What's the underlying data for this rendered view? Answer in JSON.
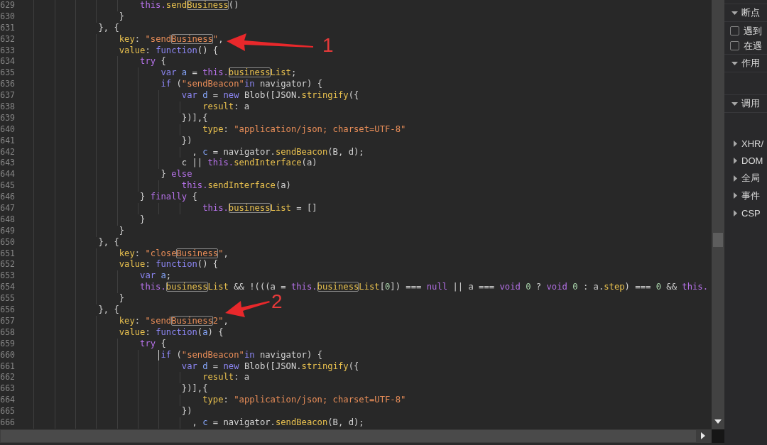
{
  "editor": {
    "lines": [
      {
        "number": "629",
        "caret": false,
        "tokens": [
          {
            "text": "                        this.",
            "kind": "special",
            "match": false
          },
          {
            "text": "send",
            "kind": "property",
            "match": false
          },
          {
            "text": "Business",
            "kind": "property",
            "match": true
          },
          {
            "text": "()",
            "kind": "plain",
            "match": false
          }
        ]
      },
      {
        "number": "630",
        "caret": false,
        "tokens": [
          {
            "text": "                    }",
            "kind": "plain",
            "match": false
          }
        ]
      },
      {
        "number": "631",
        "caret": false,
        "tokens": [
          {
            "text": "                }, {",
            "kind": "plain",
            "match": false
          }
        ]
      },
      {
        "number": "632",
        "caret": false,
        "callout": "1",
        "tokens": [
          {
            "text": "                    key",
            "kind": "property",
            "match": false
          },
          {
            "text": ": ",
            "kind": "plain",
            "match": false
          },
          {
            "text": "\"send",
            "kind": "string",
            "match": false
          },
          {
            "text": "Business",
            "kind": "string",
            "match": true
          },
          {
            "text": "\"",
            "kind": "string",
            "match": false
          },
          {
            "text": ",",
            "kind": "plain",
            "match": false
          }
        ]
      },
      {
        "number": "633",
        "caret": false,
        "tokens": [
          {
            "text": "                    value",
            "kind": "property",
            "match": false
          },
          {
            "text": ": ",
            "kind": "plain",
            "match": false
          },
          {
            "text": "function",
            "kind": "keyword",
            "match": false
          },
          {
            "text": "() {",
            "kind": "plain",
            "match": false
          }
        ]
      },
      {
        "number": "634",
        "caret": false,
        "tokens": [
          {
            "text": "                        try",
            "kind": "special",
            "match": false
          },
          {
            "text": " {",
            "kind": "plain",
            "match": false
          }
        ]
      },
      {
        "number": "635",
        "caret": false,
        "tokens": [
          {
            "text": "                            var ",
            "kind": "keyword",
            "match": false
          },
          {
            "text": "a",
            "kind": "variable",
            "match": false
          },
          {
            "text": " = ",
            "kind": "plain",
            "match": false
          },
          {
            "text": "this.",
            "kind": "special",
            "match": false
          },
          {
            "text": "business",
            "kind": "property",
            "match": true
          },
          {
            "text": "List",
            "kind": "property",
            "match": false
          },
          {
            "text": ";",
            "kind": "plain",
            "match": false
          }
        ]
      },
      {
        "number": "636",
        "caret": false,
        "tokens": [
          {
            "text": "                            if",
            "kind": "keyword",
            "match": false
          },
          {
            "text": " (",
            "kind": "plain",
            "match": false
          },
          {
            "text": "\"sendBeacon\"",
            "kind": "string",
            "match": false
          },
          {
            "text": "in",
            "kind": "keyword",
            "match": false
          },
          {
            "text": " navigator) {",
            "kind": "plain",
            "match": false
          }
        ]
      },
      {
        "number": "637",
        "caret": false,
        "tokens": [
          {
            "text": "                                var ",
            "kind": "keyword",
            "match": false
          },
          {
            "text": "d",
            "kind": "variable",
            "match": false
          },
          {
            "text": " = ",
            "kind": "plain",
            "match": false
          },
          {
            "text": "new",
            "kind": "keyword",
            "match": false
          },
          {
            "text": " Blob([JSON.",
            "kind": "plain",
            "match": false
          },
          {
            "text": "stringify",
            "kind": "property",
            "match": false
          },
          {
            "text": "({",
            "kind": "plain",
            "match": false
          }
        ]
      },
      {
        "number": "638",
        "caret": false,
        "tokens": [
          {
            "text": "                                    result",
            "kind": "property",
            "match": false
          },
          {
            "text": ": a",
            "kind": "plain",
            "match": false
          }
        ]
      },
      {
        "number": "639",
        "caret": false,
        "tokens": [
          {
            "text": "                                })],{",
            "kind": "plain",
            "match": false
          }
        ]
      },
      {
        "number": "640",
        "caret": false,
        "tokens": [
          {
            "text": "                                    type",
            "kind": "property",
            "match": false
          },
          {
            "text": ": ",
            "kind": "plain",
            "match": false
          },
          {
            "text": "\"application/json; charset=UTF-8\"",
            "kind": "string",
            "match": false
          }
        ]
      },
      {
        "number": "641",
        "caret": false,
        "tokens": [
          {
            "text": "                                })",
            "kind": "plain",
            "match": false
          }
        ]
      },
      {
        "number": "642",
        "caret": false,
        "tokens": [
          {
            "text": "                                  , ",
            "kind": "plain",
            "match": false
          },
          {
            "text": "c",
            "kind": "variable",
            "match": false
          },
          {
            "text": " = navigator.",
            "kind": "plain",
            "match": false
          },
          {
            "text": "sendBeacon",
            "kind": "property",
            "match": false
          },
          {
            "text": "(B, d);",
            "kind": "plain",
            "match": false
          }
        ]
      },
      {
        "number": "643",
        "caret": false,
        "tokens": [
          {
            "text": "                                c || ",
            "kind": "plain",
            "match": false
          },
          {
            "text": "this.",
            "kind": "special",
            "match": false
          },
          {
            "text": "sendInterface",
            "kind": "property",
            "match": false
          },
          {
            "text": "(a)",
            "kind": "plain",
            "match": false
          }
        ]
      },
      {
        "number": "644",
        "caret": false,
        "tokens": [
          {
            "text": "                            } ",
            "kind": "plain",
            "match": false
          },
          {
            "text": "else",
            "kind": "special",
            "match": false
          }
        ]
      },
      {
        "number": "645",
        "caret": false,
        "tokens": [
          {
            "text": "                                this.",
            "kind": "special",
            "match": false
          },
          {
            "text": "sendInterface",
            "kind": "property",
            "match": false
          },
          {
            "text": "(a)",
            "kind": "plain",
            "match": false
          }
        ]
      },
      {
        "number": "646",
        "caret": false,
        "tokens": [
          {
            "text": "                        } ",
            "kind": "plain",
            "match": false
          },
          {
            "text": "finally",
            "kind": "special",
            "match": false
          },
          {
            "text": " {",
            "kind": "plain",
            "match": false
          }
        ]
      },
      {
        "number": "647",
        "caret": false,
        "tokens": [
          {
            "text": "                                    this.",
            "kind": "special",
            "match": false
          },
          {
            "text": "business",
            "kind": "property",
            "match": true
          },
          {
            "text": "List",
            "kind": "property",
            "match": false
          },
          {
            "text": " = []",
            "kind": "plain",
            "match": false
          }
        ]
      },
      {
        "number": "648",
        "caret": false,
        "tokens": [
          {
            "text": "                        }",
            "kind": "plain",
            "match": false
          }
        ]
      },
      {
        "number": "649",
        "caret": false,
        "tokens": [
          {
            "text": "                    }",
            "kind": "plain",
            "match": false
          }
        ]
      },
      {
        "number": "650",
        "caret": false,
        "tokens": [
          {
            "text": "                }, {",
            "kind": "plain",
            "match": false
          }
        ]
      },
      {
        "number": "651",
        "caret": false,
        "tokens": [
          {
            "text": "                    key",
            "kind": "property",
            "match": false
          },
          {
            "text": ": ",
            "kind": "plain",
            "match": false
          },
          {
            "text": "\"close",
            "kind": "string",
            "match": false
          },
          {
            "text": "Business",
            "kind": "string",
            "match": true
          },
          {
            "text": "\"",
            "kind": "string",
            "match": false
          },
          {
            "text": ",",
            "kind": "plain",
            "match": false
          }
        ]
      },
      {
        "number": "652",
        "caret": false,
        "tokens": [
          {
            "text": "                    value",
            "kind": "property",
            "match": false
          },
          {
            "text": ": ",
            "kind": "plain",
            "match": false
          },
          {
            "text": "function",
            "kind": "keyword",
            "match": false
          },
          {
            "text": "() {",
            "kind": "plain",
            "match": false
          }
        ]
      },
      {
        "number": "653",
        "caret": false,
        "tokens": [
          {
            "text": "                        var ",
            "kind": "keyword",
            "match": false
          },
          {
            "text": "a",
            "kind": "variable",
            "match": false
          },
          {
            "text": ";",
            "kind": "plain",
            "match": false
          }
        ]
      },
      {
        "number": "654",
        "caret": false,
        "tokens": [
          {
            "text": "                        this.",
            "kind": "special",
            "match": false
          },
          {
            "text": "business",
            "kind": "property",
            "match": true
          },
          {
            "text": "List",
            "kind": "property",
            "match": false
          },
          {
            "text": " && !(((a = ",
            "kind": "plain",
            "match": false
          },
          {
            "text": "this.",
            "kind": "special",
            "match": false
          },
          {
            "text": "business",
            "kind": "property",
            "match": true
          },
          {
            "text": "List",
            "kind": "property",
            "match": false
          },
          {
            "text": "[",
            "kind": "plain",
            "match": false
          },
          {
            "text": "0",
            "kind": "number",
            "match": false
          },
          {
            "text": "]) === ",
            "kind": "plain",
            "match": false
          },
          {
            "text": "null",
            "kind": "special",
            "match": false
          },
          {
            "text": " || a === ",
            "kind": "plain",
            "match": false
          },
          {
            "text": "void ",
            "kind": "special",
            "match": false
          },
          {
            "text": "0",
            "kind": "number",
            "match": false
          },
          {
            "text": " ? ",
            "kind": "plain",
            "match": false
          },
          {
            "text": "void ",
            "kind": "special",
            "match": false
          },
          {
            "text": "0",
            "kind": "number",
            "match": false
          },
          {
            "text": " : a.",
            "kind": "plain",
            "match": false
          },
          {
            "text": "step",
            "kind": "property",
            "match": false
          },
          {
            "text": ") === ",
            "kind": "plain",
            "match": false
          },
          {
            "text": "0",
            "kind": "number",
            "match": false
          },
          {
            "text": " && ",
            "kind": "plain",
            "match": false
          },
          {
            "text": "this.",
            "kind": "special",
            "match": false
          }
        ]
      },
      {
        "number": "655",
        "caret": false,
        "tokens": [
          {
            "text": "                    }",
            "kind": "plain",
            "match": false
          }
        ]
      },
      {
        "number": "656",
        "caret": false,
        "callout": "2",
        "tokens": [
          {
            "text": "                }, {",
            "kind": "plain",
            "match": false
          }
        ]
      },
      {
        "number": "657",
        "caret": false,
        "tokens": [
          {
            "text": "                    key",
            "kind": "property",
            "match": false
          },
          {
            "text": ": ",
            "kind": "plain",
            "match": false
          },
          {
            "text": "\"send",
            "kind": "string",
            "match": false
          },
          {
            "text": "Business",
            "kind": "string",
            "match": true
          },
          {
            "text": "2\"",
            "kind": "string",
            "match": false
          },
          {
            "text": ",",
            "kind": "plain",
            "match": false
          }
        ]
      },
      {
        "number": "658",
        "caret": false,
        "tokens": [
          {
            "text": "                    value",
            "kind": "property",
            "match": false
          },
          {
            "text": ": ",
            "kind": "plain",
            "match": false
          },
          {
            "text": "function",
            "kind": "keyword",
            "match": false
          },
          {
            "text": "(",
            "kind": "plain",
            "match": false
          },
          {
            "text": "a",
            "kind": "variable",
            "match": false
          },
          {
            "text": ") {",
            "kind": "plain",
            "match": false
          }
        ]
      },
      {
        "number": "659",
        "caret": false,
        "tokens": [
          {
            "text": "                        try",
            "kind": "special",
            "match": false
          },
          {
            "text": " {",
            "kind": "plain",
            "match": false
          }
        ]
      },
      {
        "number": "660",
        "caret": true,
        "tokens": [
          {
            "text": "                            if",
            "kind": "keyword",
            "match": false
          },
          {
            "text": " (",
            "kind": "plain",
            "match": false
          },
          {
            "text": "\"sendBeacon\"",
            "kind": "string",
            "match": false
          },
          {
            "text": "in",
            "kind": "keyword",
            "match": false
          },
          {
            "text": " navigator) {",
            "kind": "plain",
            "match": false
          }
        ]
      },
      {
        "number": "661",
        "caret": false,
        "tokens": [
          {
            "text": "                                var ",
            "kind": "keyword",
            "match": false
          },
          {
            "text": "d",
            "kind": "variable",
            "match": false
          },
          {
            "text": " = ",
            "kind": "plain",
            "match": false
          },
          {
            "text": "new",
            "kind": "keyword",
            "match": false
          },
          {
            "text": " Blob([JSON.",
            "kind": "plain",
            "match": false
          },
          {
            "text": "stringify",
            "kind": "property",
            "match": false
          },
          {
            "text": "({",
            "kind": "plain",
            "match": false
          }
        ]
      },
      {
        "number": "662",
        "caret": false,
        "tokens": [
          {
            "text": "                                    result",
            "kind": "property",
            "match": false
          },
          {
            "text": ": a",
            "kind": "plain",
            "match": false
          }
        ]
      },
      {
        "number": "663",
        "caret": false,
        "tokens": [
          {
            "text": "                                })],{",
            "kind": "plain",
            "match": false
          }
        ]
      },
      {
        "number": "664",
        "caret": false,
        "tokens": [
          {
            "text": "                                    type",
            "kind": "property",
            "match": false
          },
          {
            "text": ": ",
            "kind": "plain",
            "match": false
          },
          {
            "text": "\"application/json; charset=UTF-8\"",
            "kind": "string",
            "match": false
          }
        ]
      },
      {
        "number": "665",
        "caret": false,
        "tokens": [
          {
            "text": "                                })",
            "kind": "plain",
            "match": false
          }
        ]
      },
      {
        "number": "666",
        "caret": false,
        "tokens": [
          {
            "text": "                                  , ",
            "kind": "plain",
            "match": false
          },
          {
            "text": "c",
            "kind": "variable",
            "match": false
          },
          {
            "text": " = navigator.",
            "kind": "plain",
            "match": false
          },
          {
            "text": "sendBeacon",
            "kind": "property",
            "match": false
          },
          {
            "text": "(B, d);",
            "kind": "plain",
            "match": false
          }
        ]
      }
    ]
  },
  "sidebar": {
    "sections": [
      {
        "title": "断点",
        "expanded": true,
        "options": [
          {
            "label": "遇到",
            "checked": false
          },
          {
            "label": "在遇",
            "checked": false
          }
        ]
      },
      {
        "title": "作用",
        "expanded": true
      },
      {
        "title": "调用",
        "expanded": true
      },
      {
        "title": "XHR/",
        "expanded": false
      },
      {
        "title": "DOM",
        "expanded": false
      },
      {
        "title": "全局",
        "expanded": false
      },
      {
        "title": "事件",
        "expanded": false
      },
      {
        "title": "CSP",
        "expanded": false
      }
    ]
  }
}
